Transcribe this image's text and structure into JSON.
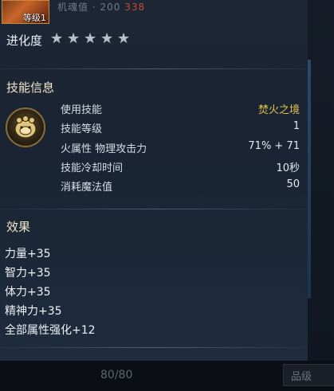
{
  "header": {
    "portrait_level": "等级1",
    "faded_text": "机魂值 · 200",
    "faded_red": "338"
  },
  "evolution": {
    "label": "进化度",
    "stars_filled": 5,
    "stars_total": 5,
    "star_glyph": "★"
  },
  "skill_section": {
    "title": "技能信息",
    "icon": "beast-claw-icon",
    "rows": [
      {
        "key": "使用技能",
        "value": "焚火之境"
      },
      {
        "key": "技能等级",
        "value": "1"
      },
      {
        "key": "火属性 物理攻击力",
        "value": "71% + 71"
      },
      {
        "key": "技能冷却时间",
        "value": "10秒"
      },
      {
        "key": "消耗魔法值",
        "value": "50"
      }
    ]
  },
  "effects_section": {
    "title": "效果",
    "items": [
      "力量+35",
      "智力+35",
      "体力+35",
      "精神力+35",
      "全部属性强化+12"
    ]
  },
  "footer": {
    "count": "80/80",
    "tab_label": "品级"
  },
  "colors": {
    "gold": "#e6c24a",
    "section_title": "#f1e7c8",
    "panel": "#1c2634"
  }
}
